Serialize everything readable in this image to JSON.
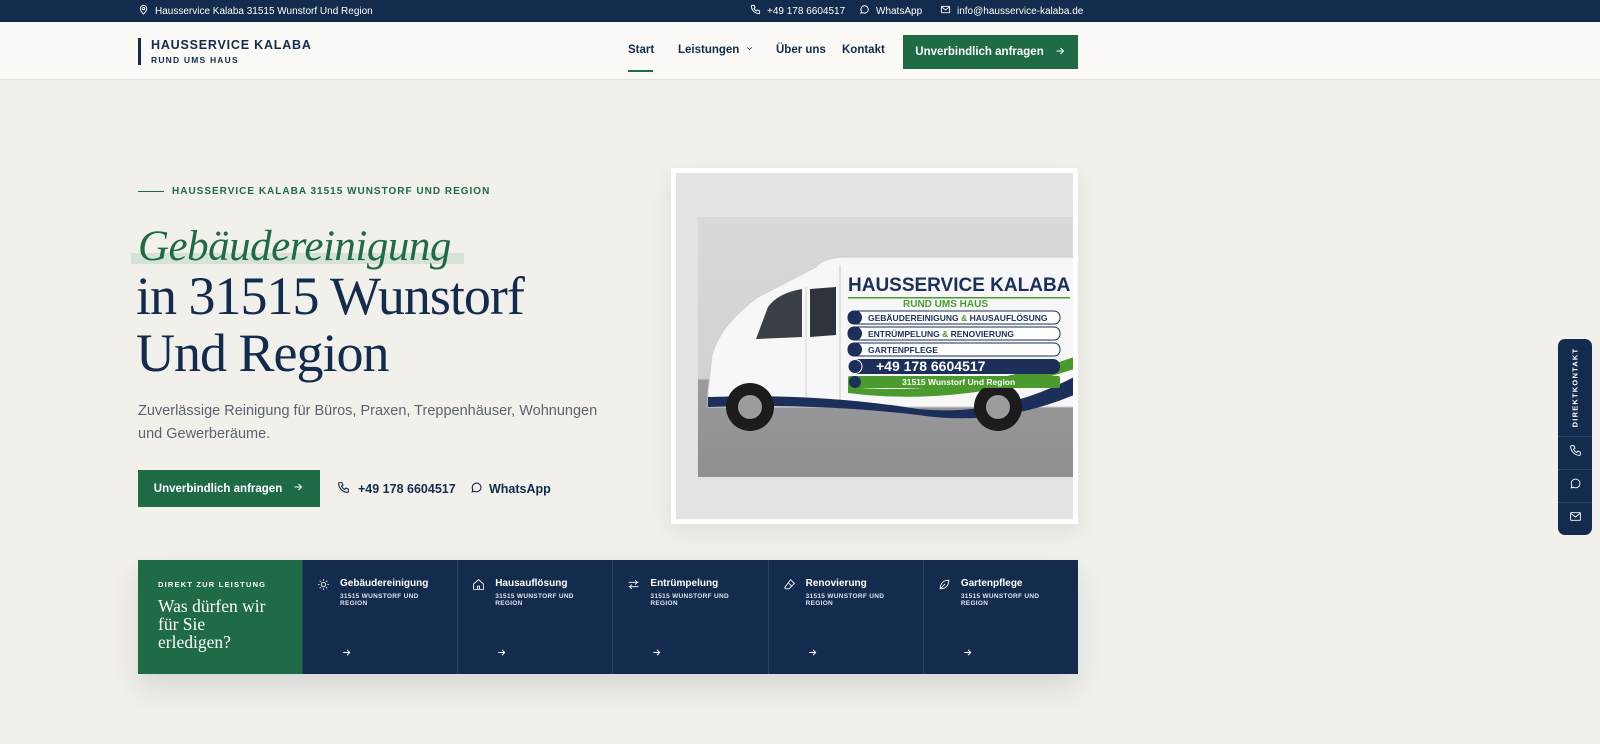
{
  "topbar": {
    "address": "Hausservice Kalaba 31515 Wunstorf Und Region",
    "phone": "+49 178 6604517",
    "whatsapp": "WhatsApp",
    "email": "info@hausservice-kalaba.de"
  },
  "header": {
    "logo_title": "HAUSSERVICE KALABA",
    "logo_sub": "RUND UMS HAUS",
    "nav": [
      "Start",
      "Leistungen",
      "Über uns",
      "Kontakt"
    ],
    "cta": "Unverbindlich anfragen"
  },
  "hero": {
    "eyebrow": "HAUSSERVICE KALABA 31515 WUNSTORF UND REGION",
    "title_italic": "Gebäudereinigung",
    "title_line1": "in 31515 Wunstorf",
    "title_line2": "Und Region",
    "description": "Zuverlässige Reinigung für Büros, Praxen, Treppenhäuser, Wohnungen und Gewerberäume.",
    "cta": "Unverbindlich anfragen",
    "phone": "+49 178 6604517",
    "whatsapp": "WhatsApp"
  },
  "van": {
    "title": "HAUSSERVICE KALABA",
    "sub": "RUND UMS HAUS",
    "line1a": "GEBÄUDEREINIGUNG",
    "line1b": "HAUSAUFLÖSUNG",
    "line2a": "ENTRÜMPELUNG",
    "line2b": "RENOVIERUNG",
    "amp": "&",
    "line3": "GARTENPFLEGE",
    "phone": "+49 178 6604517",
    "location": "31515 Wunstorf Und Region"
  },
  "services": {
    "eyebrow": "DIREKT ZUR LEISTUNG",
    "question": "Was dürfen wir für Sie erledigen?",
    "items": [
      {
        "name": "Gebäudereinigung",
        "loc": "31515 WUNSTORF UND REGION",
        "icon": "sun-icon"
      },
      {
        "name": "Hausauflösung",
        "loc": "31515 WUNSTORF UND REGION",
        "icon": "house-icon"
      },
      {
        "name": "Entrümpelung",
        "loc": "31515 WUNSTORF UND REGION",
        "icon": "sliders-icon"
      },
      {
        "name": "Renovierung",
        "loc": "31515 WUNSTORF UND REGION",
        "icon": "eraser-icon"
      },
      {
        "name": "Gartenpflege",
        "loc": "31515 WUNSTORF UND REGION",
        "icon": "leaf-icon"
      }
    ]
  },
  "side": {
    "label": "DIREKTKONTAKT"
  },
  "colors": {
    "navy": "#132b4c",
    "green": "#1e6b45",
    "background": "#f2f0ea"
  }
}
